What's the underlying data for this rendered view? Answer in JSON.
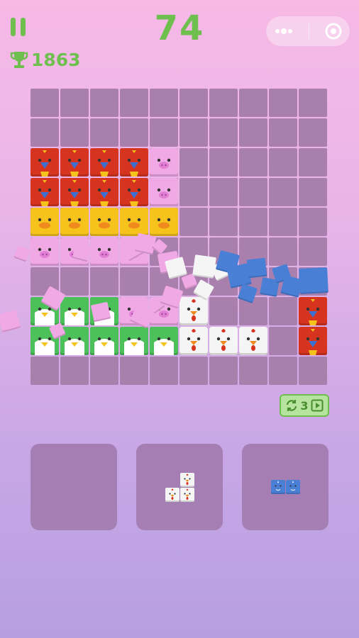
{
  "hud": {
    "score": "74",
    "best_score": "1863",
    "refresh_count": "3"
  },
  "colors": {
    "accent": "#6fbf4f",
    "empty_cell": "#a97fae",
    "parrot": "#d6341f",
    "pig": "#f1a9e6",
    "duck": "#f6c21c",
    "penguin": "#4cc15a",
    "chicken": "#f5f5f5",
    "rhino": "#4a7fd6"
  },
  "board": {
    "cols": 10,
    "rows": 10,
    "tiles": [
      {
        "r": 2,
        "c": 0,
        "kind": "parrot"
      },
      {
        "r": 2,
        "c": 1,
        "kind": "parrot"
      },
      {
        "r": 2,
        "c": 2,
        "kind": "parrot"
      },
      {
        "r": 2,
        "c": 3,
        "kind": "parrot"
      },
      {
        "r": 2,
        "c": 4,
        "kind": "pig"
      },
      {
        "r": 3,
        "c": 0,
        "kind": "parrot"
      },
      {
        "r": 3,
        "c": 1,
        "kind": "parrot"
      },
      {
        "r": 3,
        "c": 2,
        "kind": "parrot"
      },
      {
        "r": 3,
        "c": 3,
        "kind": "parrot"
      },
      {
        "r": 3,
        "c": 4,
        "kind": "pig"
      },
      {
        "r": 4,
        "c": 0,
        "kind": "duck"
      },
      {
        "r": 4,
        "c": 1,
        "kind": "duck"
      },
      {
        "r": 4,
        "c": 2,
        "kind": "duck"
      },
      {
        "r": 4,
        "c": 3,
        "kind": "duck"
      },
      {
        "r": 4,
        "c": 4,
        "kind": "duck"
      },
      {
        "r": 5,
        "c": 0,
        "kind": "pig"
      },
      {
        "r": 5,
        "c": 1,
        "kind": "pig"
      },
      {
        "r": 5,
        "c": 2,
        "kind": "pig"
      },
      {
        "r": 5,
        "c": 3,
        "kind": "pig"
      },
      {
        "r": 7,
        "c": 0,
        "kind": "penguin"
      },
      {
        "r": 7,
        "c": 1,
        "kind": "penguin"
      },
      {
        "r": 7,
        "c": 2,
        "kind": "penguin"
      },
      {
        "r": 7,
        "c": 3,
        "kind": "pig"
      },
      {
        "r": 7,
        "c": 4,
        "kind": "pig"
      },
      {
        "r": 7,
        "c": 5,
        "kind": "chicken"
      },
      {
        "r": 7,
        "c": 9,
        "kind": "parrot"
      },
      {
        "r": 8,
        "c": 0,
        "kind": "penguin"
      },
      {
        "r": 8,
        "c": 1,
        "kind": "penguin"
      },
      {
        "r": 8,
        "c": 2,
        "kind": "penguin"
      },
      {
        "r": 8,
        "c": 3,
        "kind": "penguin"
      },
      {
        "r": 8,
        "c": 4,
        "kind": "penguin"
      },
      {
        "r": 8,
        "c": 5,
        "kind": "chicken"
      },
      {
        "r": 8,
        "c": 6,
        "kind": "chicken"
      },
      {
        "r": 8,
        "c": 7,
        "kind": "chicken"
      },
      {
        "r": 8,
        "c": 9,
        "kind": "parrot"
      }
    ]
  },
  "trays": [
    {
      "kind": "empty",
      "cells": []
    },
    {
      "kind": "chicken",
      "cells": [
        [
          0,
          1
        ],
        [
          1,
          0
        ],
        [
          1,
          1
        ]
      ]
    },
    {
      "kind": "rhino",
      "cells": [
        [
          0,
          0
        ],
        [
          0,
          1
        ]
      ]
    }
  ]
}
